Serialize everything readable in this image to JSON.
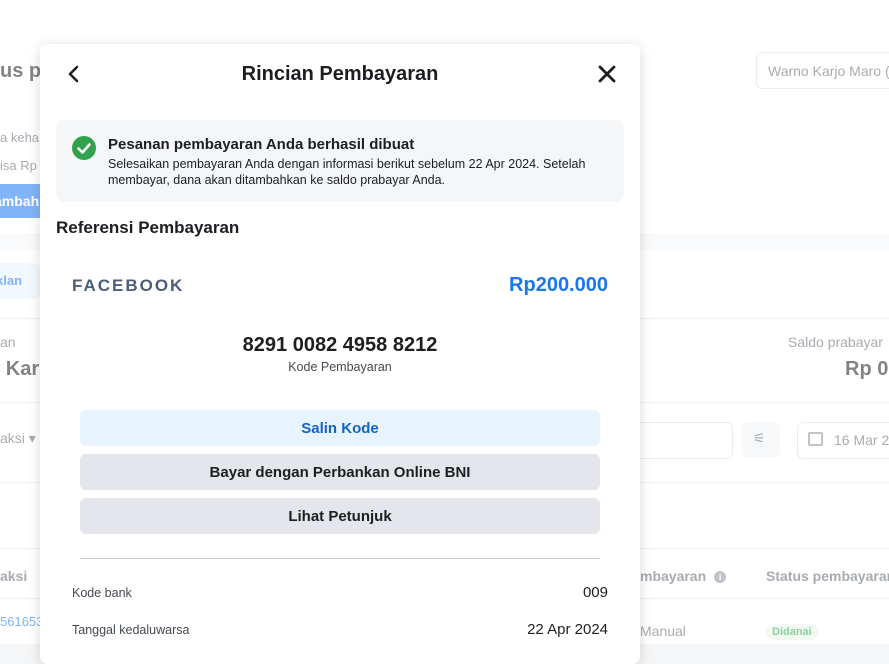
{
  "background": {
    "page_title": "us pe",
    "search_value": "Warno Karjo Maro (",
    "info_line_1": "a keha",
    "info_line_2": "isa Rp",
    "add_button": "ambah",
    "tab_label": "klan",
    "left_label": "an",
    "left_value": "o Kar",
    "prepaid_label": "Saldo prabayar",
    "prepaid_value": "Rp 0",
    "select_label": "aksi ▾",
    "date_value": "16 Mar 2",
    "col_transaction": "aksi",
    "col_payment": "mbayaran",
    "col_status": "Status pembayaran",
    "row_id": "561653",
    "row_method": "Manual",
    "row_status": "Didanai"
  },
  "modal": {
    "title": "Rincian Pembayaran",
    "back_icon": "chevron-left-icon",
    "close_icon": "close-icon",
    "banner": {
      "icon": "check-circle-icon",
      "title": "Pesanan pembayaran Anda berhasil dibuat",
      "description": "Selesaikan pembayaran Anda dengan informasi berikut sebelum 22 Apr 2024. Setelah membayar, dana akan ditambahkan ke saldo prabayar Anda."
    },
    "reference_title": "Referensi Pembayaran",
    "brand": "FACEBOOK",
    "amount": "Rp200.000",
    "payment_code": "8291 0082 4958 8212",
    "payment_code_label": "Kode Pembayaran",
    "buttons": {
      "copy": "Salin Kode",
      "pay_bank": "Bayar dengan Perbankan Online BNI",
      "instructions": "Lihat Petunjuk"
    },
    "details": [
      {
        "label": "Kode bank",
        "value": "009"
      },
      {
        "label": "Tanggal kedaluwarsa",
        "value": "22 Apr 2024"
      }
    ]
  },
  "colors": {
    "accent": "#1877f2",
    "success": "#31a24c",
    "secondary_button": "#e4e6eb"
  }
}
